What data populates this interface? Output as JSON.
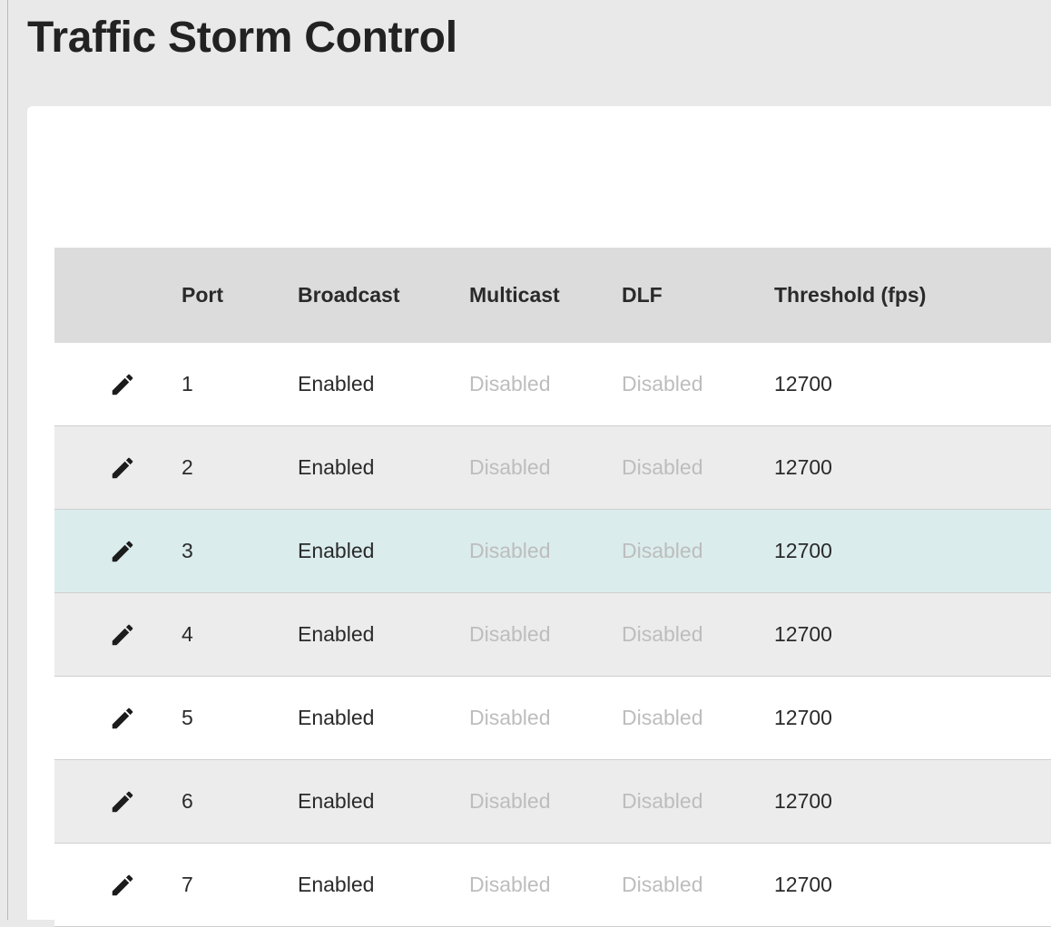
{
  "page": {
    "title": "Traffic Storm Control"
  },
  "table": {
    "columns": {
      "port": "Port",
      "broadcast": "Broadcast",
      "multicast": "Multicast",
      "dlf": "DLF",
      "threshold": "Threshold (fps)"
    },
    "edit_icon": "pencil-icon",
    "selected_row": 3,
    "rows": [
      {
        "port": "1",
        "broadcast": "Enabled",
        "multicast": "Disabled",
        "dlf": "Disabled",
        "threshold": "12700"
      },
      {
        "port": "2",
        "broadcast": "Enabled",
        "multicast": "Disabled",
        "dlf": "Disabled",
        "threshold": "12700"
      },
      {
        "port": "3",
        "broadcast": "Enabled",
        "multicast": "Disabled",
        "dlf": "Disabled",
        "threshold": "12700"
      },
      {
        "port": "4",
        "broadcast": "Enabled",
        "multicast": "Disabled",
        "dlf": "Disabled",
        "threshold": "12700"
      },
      {
        "port": "5",
        "broadcast": "Enabled",
        "multicast": "Disabled",
        "dlf": "Disabled",
        "threshold": "12700"
      },
      {
        "port": "6",
        "broadcast": "Enabled",
        "multicast": "Disabled",
        "dlf": "Disabled",
        "threshold": "12700"
      },
      {
        "port": "7",
        "broadcast": "Enabled",
        "multicast": "Disabled",
        "dlf": "Disabled",
        "threshold": "12700"
      }
    ]
  },
  "colors": {
    "background": "#e9e9e9",
    "card": "#ffffff",
    "header_row": "#dcdcdc",
    "striped_row": "#ececec",
    "selected_row": "#dbecec",
    "text": "#2a2a2a",
    "disabled_text": "#bdbdbd"
  }
}
